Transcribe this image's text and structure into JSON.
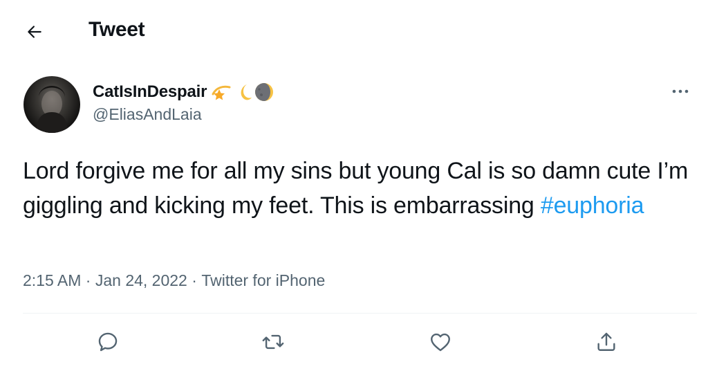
{
  "header": {
    "back_icon": "arrow-left-icon",
    "title": "Tweet"
  },
  "author": {
    "display_name": "CatIsInDespair",
    "name_emojis": [
      "shooting-star-emoji",
      "crescent-moon-emoji",
      "last-quarter-moon-emoji"
    ],
    "handle": "@EliasAndLaia",
    "more_icon": "more-horizontal-icon"
  },
  "tweet": {
    "text": "Lord forgive me for all my sins but young Cal is so damn cute I’m giggling and kicking my feet. This is embarrassing ",
    "hashtag": "#euphoria"
  },
  "meta": {
    "time": "2:15 AM",
    "separator": " · ",
    "date": "Jan 24, 2022",
    "source": "Twitter for iPhone"
  },
  "actions": [
    {
      "name": "reply",
      "icon": "reply-icon"
    },
    {
      "name": "retweet",
      "icon": "retweet-icon"
    },
    {
      "name": "like",
      "icon": "heart-icon"
    },
    {
      "name": "share",
      "icon": "share-icon"
    }
  ],
  "colors": {
    "text_primary": "#0f1419",
    "text_secondary": "#536471",
    "hashtag": "#1d9bf0",
    "divider": "#eff3f4"
  }
}
